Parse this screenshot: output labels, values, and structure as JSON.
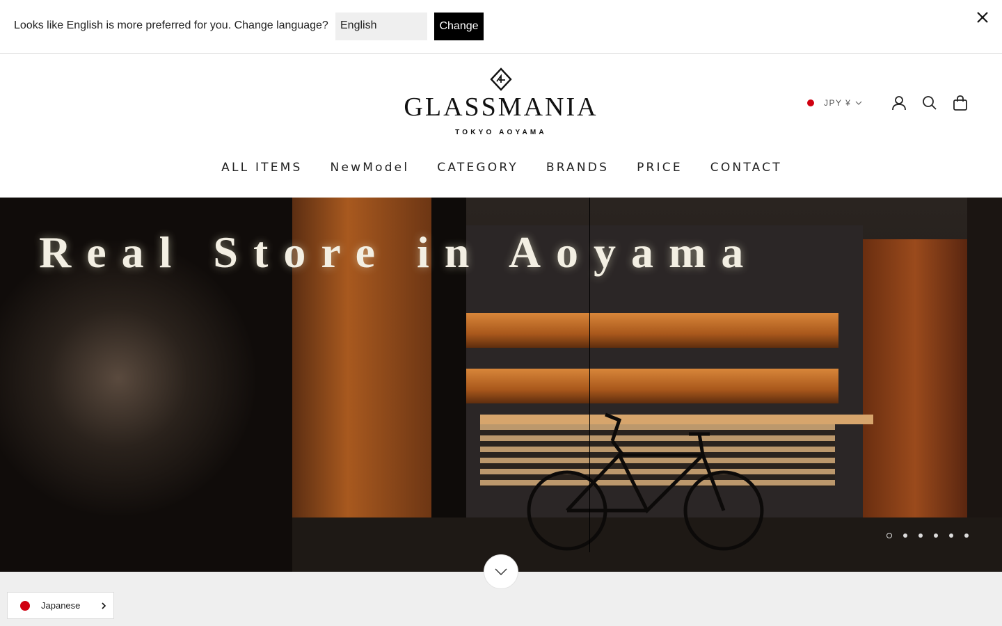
{
  "language_banner": {
    "message": "Looks like English is more preferred for you. Change language?",
    "selected_language": "English",
    "change_label": "Change"
  },
  "header": {
    "logo": {
      "wordmark": "GLASSMANIA",
      "subtitle": "TOKYO AOYAMA"
    },
    "currency": {
      "label": "JPY ¥",
      "flag_color": "#d00010"
    },
    "icons": [
      "account-icon",
      "search-icon",
      "cart-icon"
    ]
  },
  "nav": {
    "items": [
      {
        "label": "ALL ITEMS"
      },
      {
        "label": "NewModel"
      },
      {
        "label": "CATEGORY"
      },
      {
        "label": "BRANDS"
      },
      {
        "label": "PRICE"
      },
      {
        "label": "CONTACT"
      }
    ]
  },
  "hero": {
    "headline": "Real Store in Aoyama",
    "slide_count": 6,
    "active_slide": 1
  },
  "language_switcher": {
    "label": "Japanese",
    "flag_color": "#d00010"
  },
  "colors": {
    "accent": "#000000",
    "flag": "#d00010",
    "below_bg": "#efefef"
  }
}
